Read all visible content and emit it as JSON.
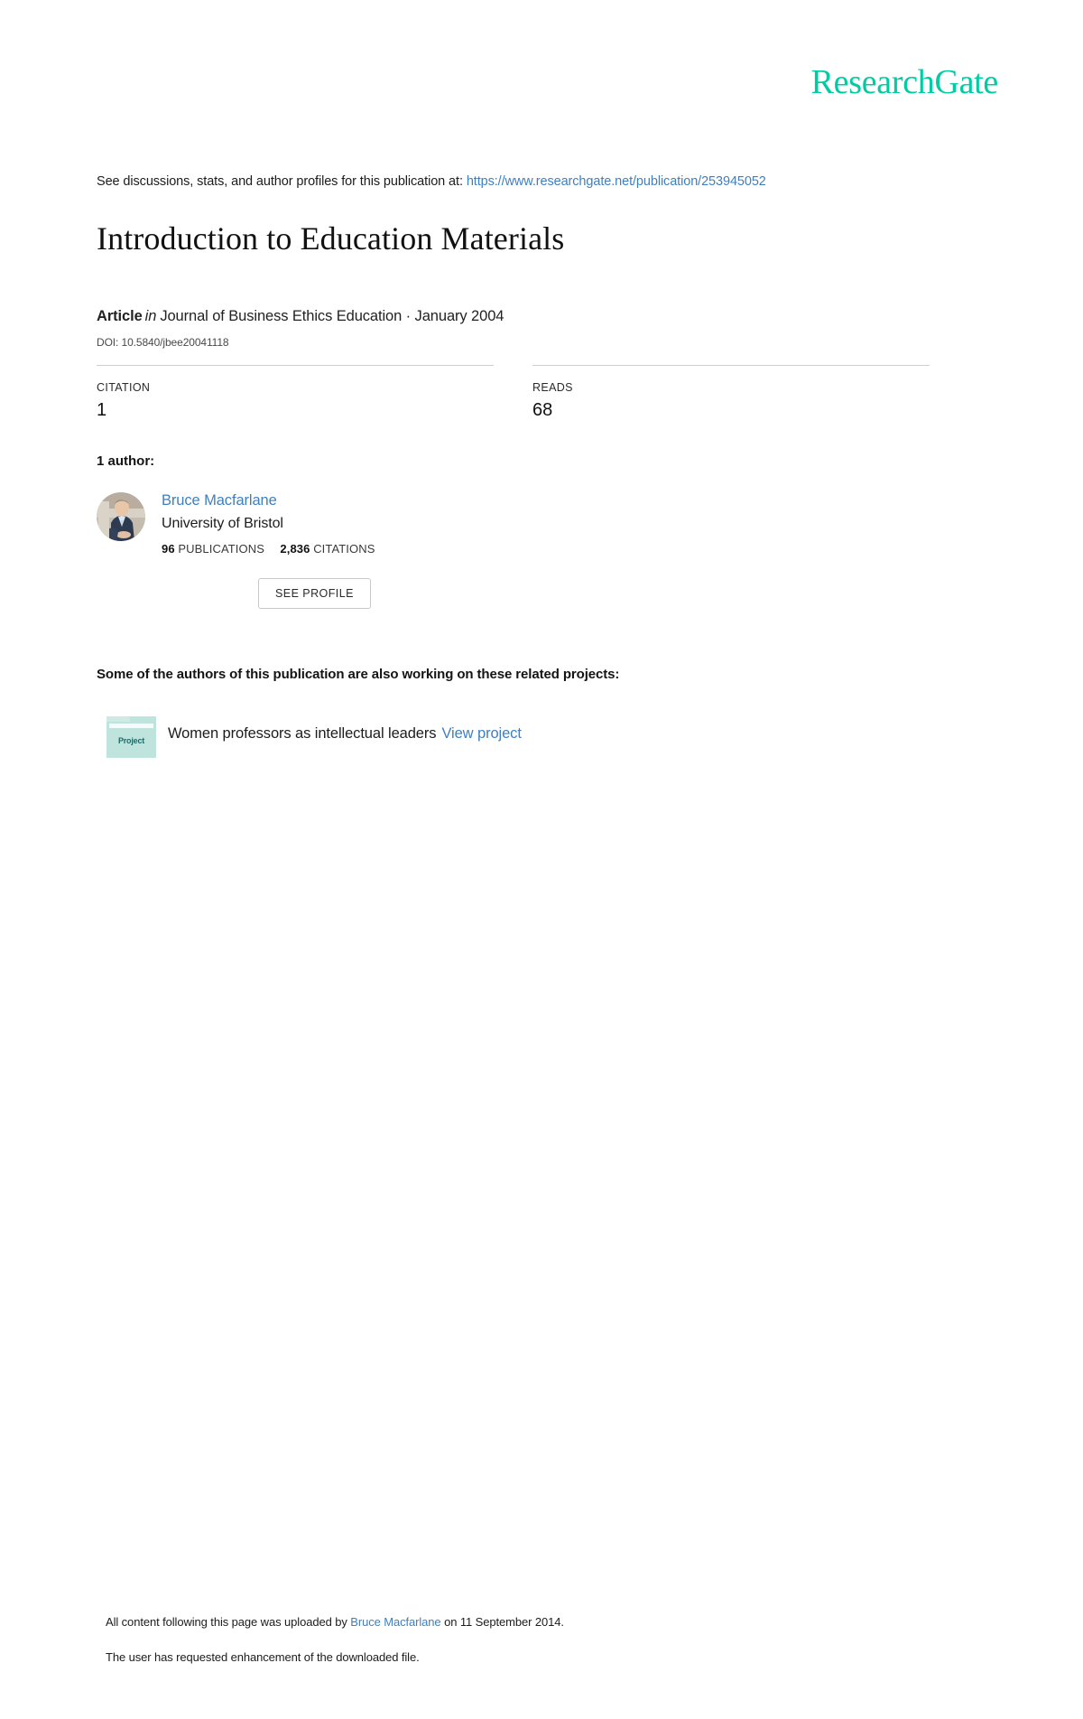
{
  "brand": {
    "logo_text": "ResearchGate",
    "accent_color": "#00cca4",
    "link_color": "#3f7fc1"
  },
  "header": {
    "discussion_prefix": "See discussions, stats, and author profiles for this publication at:",
    "publication_url": "https://www.researchgate.net/publication/253945052"
  },
  "publication": {
    "title": "Introduction to Education Materials",
    "type_label": "Article",
    "in_word": "in",
    "venue": "Journal of Business Ethics Education · January 2004",
    "doi": "DOI: 10.5840/jbee20041118"
  },
  "stats": [
    {
      "label": "CITATION",
      "value": "1"
    },
    {
      "label": "READS",
      "value": "68"
    }
  ],
  "authors_section": {
    "heading": "1 author:",
    "author": {
      "name": "Bruce Macfarlane",
      "affiliation": "University of Bristol",
      "publications_count": "96",
      "publications_label": "PUBLICATIONS",
      "citations_count": "2,836",
      "citations_label": "CITATIONS",
      "see_profile_label": "SEE PROFILE"
    }
  },
  "projects_section": {
    "heading": "Some of the authors of this publication are also working on these related projects:",
    "project": {
      "icon_label": "Project",
      "title": "Women professors as intellectual leaders",
      "view_link_label": "View project"
    }
  },
  "footer": {
    "upload_prefix": "All content following this page was uploaded by",
    "uploader_name": "Bruce Macfarlane",
    "upload_suffix": "on 11 September 2014.",
    "enhancement_note": "The user has requested enhancement of the downloaded file."
  }
}
